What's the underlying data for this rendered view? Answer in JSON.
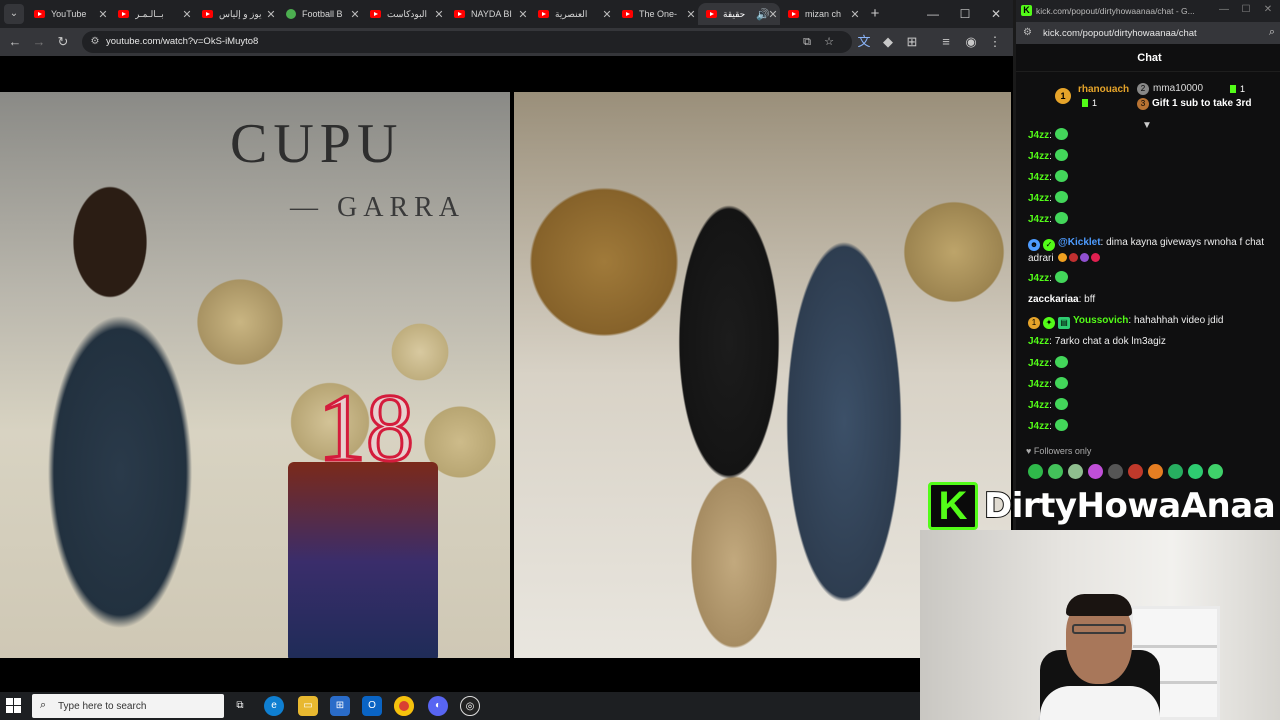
{
  "browser": {
    "tabs": [
      {
        "label": "YouTube",
        "icon": "youtube-icon"
      },
      {
        "label": "بــالـمـر",
        "icon": "youtube-icon"
      },
      {
        "label": "يوز و إلياس",
        "icon": "youtube-icon"
      },
      {
        "label": "Football B",
        "icon": "globe-icon"
      },
      {
        "label": "البودكاست",
        "icon": "youtube-icon"
      },
      {
        "label": "NAYDA BI",
        "icon": "youtube-icon"
      },
      {
        "label": "العنصرية",
        "icon": "youtube-icon"
      },
      {
        "label": "The One-",
        "icon": "youtube-icon"
      },
      {
        "label": "حقيقة",
        "icon": "youtube-icon",
        "active": true
      },
      {
        "label": "mizan ch",
        "icon": "youtube-icon"
      }
    ],
    "new_tab": "+",
    "url": "youtube.com/watch?v=OkS-iMuyto8",
    "window_controls": {
      "minimize": "—",
      "maximize": "☐",
      "close": "✕"
    }
  },
  "video": {
    "sign_line1": "CUPU",
    "sign_line2": "— GARRA",
    "cake_number": "18"
  },
  "kick": {
    "window_title": "kick.com/popout/dirtyhowaanaa/chat - G...",
    "url": "kick.com/popout/dirtyhowaanaa/chat",
    "chat_title": "Chat",
    "leaderboard": {
      "first": {
        "rank": "1",
        "name": "rhanouach",
        "count": "1"
      },
      "second": {
        "name": "mma10000",
        "count": "1"
      },
      "cta": "Gift 1 sub to take 3rd"
    },
    "messages": [
      {
        "user": "J4zz",
        "text": "",
        "heart": true
      },
      {
        "user": "J4zz",
        "text": "",
        "heart": true
      },
      {
        "user": "J4zz",
        "text": "",
        "heart": true
      },
      {
        "user": "J4zz",
        "text": "",
        "heart": true
      },
      {
        "user": "J4zz",
        "text": "",
        "heart": true
      },
      {
        "user": "@Kicklet",
        "text": "dima kayna giveways rwnoha f chat adrari",
        "bot": true
      },
      {
        "user": "J4zz",
        "text": "",
        "heart": true
      },
      {
        "user": "zacckariaa",
        "text": "bff"
      },
      {
        "user": "Youssovich",
        "text": "hahahhah video jdid",
        "sub": true
      },
      {
        "user": "J4zz",
        "text": "7arko chat a dok lm3agiz"
      },
      {
        "user": "J4zz",
        "text": "",
        "heart": true
      },
      {
        "user": "J4zz",
        "text": "",
        "heart": true
      },
      {
        "user": "J4zz",
        "text": "",
        "heart": true
      },
      {
        "user": "J4zz",
        "text": "",
        "heart": true
      }
    ],
    "followers_only": "Followers only",
    "colors": {
      "kick_green": "#53fc18",
      "j4zz": "#53fc18",
      "kicklet": "#4e9cff",
      "zacckariaa": "#ffffff",
      "youssovich": "#53fc18"
    }
  },
  "overlay": {
    "brand_letter": "K",
    "brand_name": "DirtyHowaAnaa"
  },
  "taskbar": {
    "search_placeholder": "Type here to search",
    "apps": [
      "task-view-icon",
      "edge-icon",
      "file-explorer-icon",
      "store-icon",
      "outlook-icon",
      "chrome-icon",
      "discord-icon",
      "obs-icon"
    ]
  }
}
